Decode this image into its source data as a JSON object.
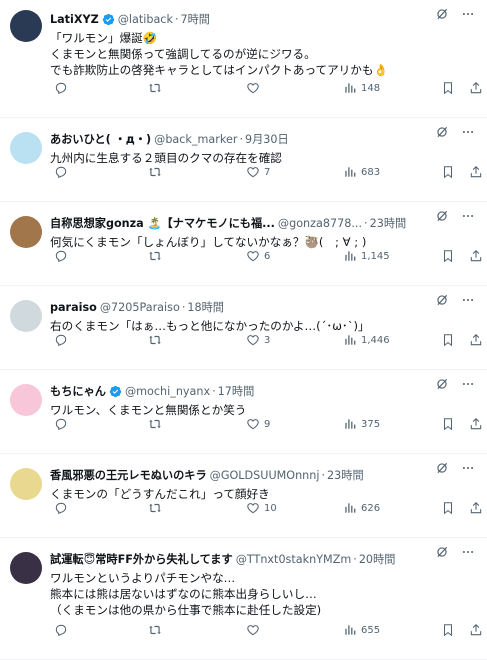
{
  "tweets": [
    {
      "name": "LatiXYZ",
      "verified": true,
      "handle": "@latiback",
      "time": "7時間",
      "lines": [
        "「ワルモン」爆誕🤣",
        "くまモンと無関係って強調してるのが逆にジワる。",
        "でも詐欺防止の啓発キャラとしてはインパクトあってアリかも👌"
      ],
      "replies": "",
      "retweets": "",
      "likes": "",
      "views": "148",
      "avatar_color": "#2a3a55"
    },
    {
      "name": "あおいひと( ・д・)",
      "verified": false,
      "handle": "@back_marker",
      "time": "9月30日",
      "lines": [
        "九州内に生息する２頭目のクマの存在を確認"
      ],
      "replies": "",
      "retweets": "",
      "likes": "7",
      "views": "683",
      "avatar_color": "#b9e1f2"
    },
    {
      "name": "自称思想家gonza 🏝️【ナマケモノにも福...",
      "verified": false,
      "handle": "@gonza8778...",
      "time": "23時間",
      "lines": [
        "何気にくまモン「しょんぼり」してないかなぁ？🦥(　; ∀ ; )"
      ],
      "replies": "",
      "retweets": "",
      "likes": "6",
      "views": "1,145",
      "avatar_color": "#a0764a"
    },
    {
      "name": "paraiso",
      "verified": false,
      "handle": "@7205Paraiso",
      "time": "18時間",
      "lines": [
        "右のくまモン「はぁ…もっと他になかったのかよ…(´･ω･`)」"
      ],
      "replies": "",
      "retweets": "",
      "likes": "3",
      "views": "1,446",
      "avatar_color": "#cfd9de"
    },
    {
      "name": "もちにゃん",
      "verified": true,
      "handle": "@mochi_nyanx",
      "time": "17時間",
      "lines": [
        "ワルモン、くまモンと無関係とか笑う"
      ],
      "replies": "",
      "retweets": "",
      "likes": "9",
      "views": "375",
      "avatar_color": "#f7c6d8"
    },
    {
      "name": "香風邪悪の王元レモぬいのキラ",
      "verified": false,
      "handle": "@GOLDSUUMOnnnj",
      "time": "23時間",
      "lines": [
        "くまモンの「どうすんだこれ」って顔好き"
      ],
      "replies": "",
      "retweets": "",
      "likes": "10",
      "views": "626",
      "avatar_color": "#e8d890"
    },
    {
      "name": "試運転😇常時FF外から失礼してます",
      "verified": false,
      "handle": "@TTnxt0staknYMZm",
      "time": "20時間",
      "lines": [
        "ワルモンというよりパチモンやな…",
        "熊本には熊は居ないはずなのに熊本出身らしいし…",
        "（くまモンは他の県から仕事で熊本に赴任した設定)"
      ],
      "replies": "",
      "retweets": "",
      "likes": "",
      "views": "655",
      "avatar_color": "#3a3046"
    }
  ],
  "colors": {
    "accent": "#1d9bf0",
    "muted": "#536471",
    "divider": "#eff3f4"
  },
  "icons": {
    "reply": "reply-icon",
    "retweet": "retweet-icon",
    "like": "heart-icon",
    "views": "views-chart-icon",
    "bookmark": "bookmark-icon",
    "share": "share-icon",
    "grok": "grok-icon",
    "more": "more-dots-icon",
    "verified": "verified-badge-icon"
  }
}
